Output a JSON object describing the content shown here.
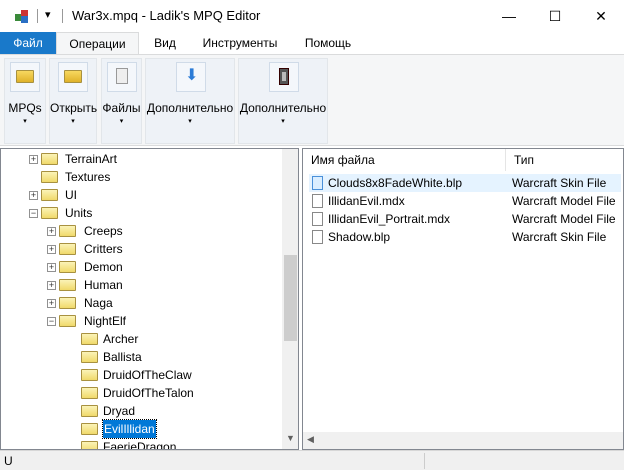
{
  "window": {
    "title": "War3x.mpq - Ladik's MPQ Editor",
    "quick_access": "▾",
    "minimize": "—",
    "maximize": "☐",
    "close": "✕"
  },
  "menu": {
    "tabs": [
      {
        "label": "Файл"
      },
      {
        "label": "Операции"
      },
      {
        "label": "Вид"
      },
      {
        "label": "Инструменты"
      },
      {
        "label": "Помощь"
      }
    ],
    "active": "Операции"
  },
  "ribbon": {
    "groups": [
      {
        "label": "MPQs",
        "icon": "folder-icon"
      },
      {
        "label": "Открыть",
        "icon": "folder-icon"
      },
      {
        "label": "Файлы",
        "icon": "document-icon"
      },
      {
        "label": "Дополнительно",
        "icon": "download-arrow-icon"
      },
      {
        "label": "Дополнительно",
        "icon": "archive-icon"
      }
    ],
    "dropdown": "▾"
  },
  "tree": {
    "items": [
      {
        "label": "TerrainArt",
        "level": 1,
        "expander": "+"
      },
      {
        "label": "Textures",
        "level": 1,
        "expander": ""
      },
      {
        "label": "UI",
        "level": 1,
        "expander": "+"
      },
      {
        "label": "Units",
        "level": 1,
        "expander": "−"
      },
      {
        "label": "Creeps",
        "level": 2,
        "expander": "+"
      },
      {
        "label": "Critters",
        "level": 2,
        "expander": "+"
      },
      {
        "label": "Demon",
        "level": 2,
        "expander": "+"
      },
      {
        "label": "Human",
        "level": 2,
        "expander": "+"
      },
      {
        "label": "Naga",
        "level": 2,
        "expander": "+"
      },
      {
        "label": "NightElf",
        "level": 2,
        "expander": "−"
      },
      {
        "label": "Archer",
        "level": 3,
        "expander": ""
      },
      {
        "label": "Ballista",
        "level": 3,
        "expander": ""
      },
      {
        "label": "DruidOfTheClaw",
        "level": 3,
        "expander": ""
      },
      {
        "label": "DruidOfTheTalon",
        "level": 3,
        "expander": ""
      },
      {
        "label": "Dryad",
        "level": 3,
        "expander": ""
      },
      {
        "label": "EvilIllidan",
        "level": 3,
        "expander": "",
        "selected": true
      },
      {
        "label": "FaerieDragon",
        "level": 3,
        "expander": ""
      }
    ]
  },
  "files": {
    "columns": [
      "Имя файла",
      "Тип"
    ],
    "rows": [
      {
        "name": "Clouds8x8FadeWhite.blp",
        "type": "Warcraft Skin File",
        "selected": true
      },
      {
        "name": "IllidanEvil.mdx",
        "type": "Warcraft Model File"
      },
      {
        "name": "IllidanEvil_Portrait.mdx",
        "type": "Warcraft Model File"
      },
      {
        "name": "Shadow.blp",
        "type": "Warcraft Skin File"
      }
    ]
  },
  "status": {
    "text": "U"
  },
  "colors": {
    "accent": "#1979ca",
    "selection": "#0078d7"
  }
}
